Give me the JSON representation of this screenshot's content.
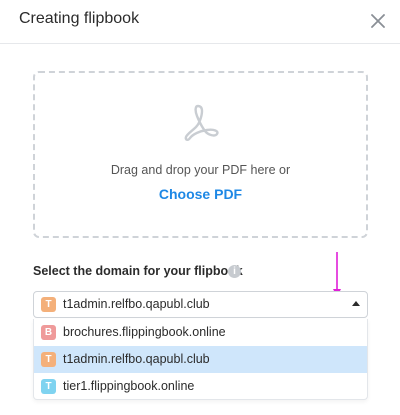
{
  "dialog": {
    "title": "Creating flipbook",
    "close_icon": "close-icon"
  },
  "upload": {
    "icon": "pdf-icon",
    "drop_text": "Drag and drop your PDF here or",
    "choose_label": "Choose PDF"
  },
  "domain": {
    "label": "Select the domain for your flipbook",
    "info_icon": "i",
    "selected": {
      "badge": "T",
      "badge_color": "#f4b07a",
      "text": "t1admin.relfbo.qapubl.club"
    },
    "options": [
      {
        "badge": "B",
        "badge_color": "#ef9a9a",
        "text": "brochures.flippingbook.online",
        "selected": false
      },
      {
        "badge": "T",
        "badge_color": "#f4b07a",
        "text": "t1admin.relfbo.qapubl.club",
        "selected": true
      },
      {
        "badge": "T",
        "badge_color": "#7fd3f0",
        "text": "tier1.flippingbook.online",
        "selected": false
      }
    ]
  },
  "colors": {
    "accent": "#1e88e5",
    "selected_row": "#cfe6fb",
    "annotation_arrow": "#e020d8"
  }
}
